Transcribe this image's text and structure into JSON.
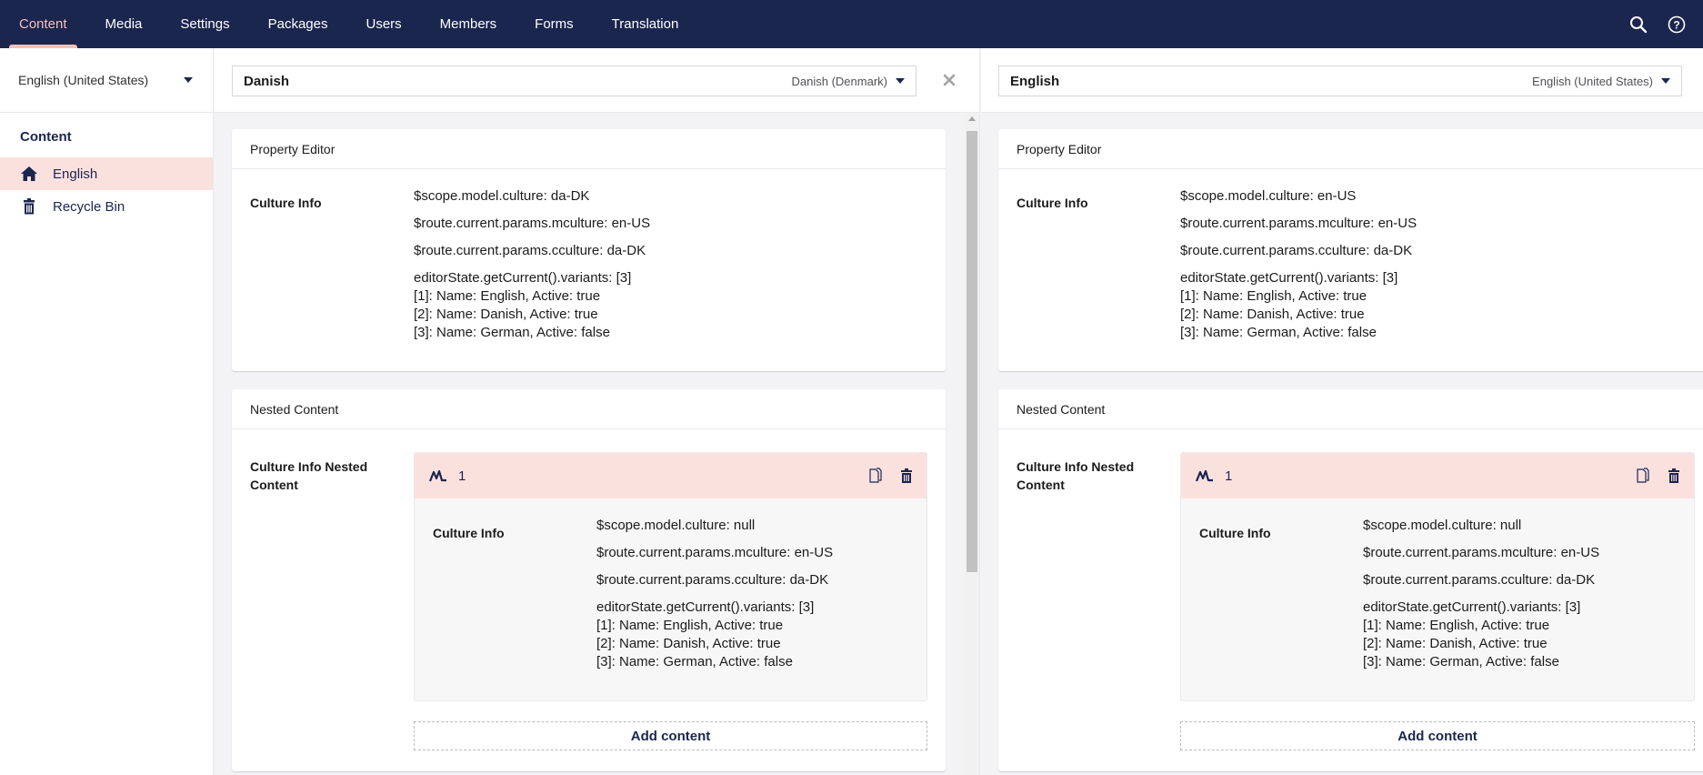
{
  "topnav": {
    "items": [
      {
        "label": "Content",
        "active": true
      },
      {
        "label": "Media"
      },
      {
        "label": "Settings"
      },
      {
        "label": "Packages"
      },
      {
        "label": "Users"
      },
      {
        "label": "Members"
      },
      {
        "label": "Forms"
      },
      {
        "label": "Translation"
      }
    ],
    "icons": [
      "search-icon",
      "help-icon"
    ]
  },
  "sidebar": {
    "culture": "English (United States)",
    "section_title": "Content",
    "items": [
      {
        "label": "English",
        "icon": "home-icon",
        "active": true
      },
      {
        "label": "Recycle Bin",
        "icon": "trash-icon"
      }
    ]
  },
  "panes": [
    {
      "variant_name": "Danish",
      "variant_culture": "Danish (Denmark)",
      "close_icon": "close-icon",
      "property_editor": {
        "header": "Property Editor",
        "label": "Culture Info",
        "lines": [
          "$scope.model.culture: da-DK",
          "$route.current.params.mculture: en-US",
          "$route.current.params.cculture: da-DK"
        ],
        "variants": [
          "editorState.getCurrent().variants: [3]",
          "[1]: Name: English, Active: true",
          "[2]: Name: Danish, Active: true",
          "[3]: Name: German, Active: false"
        ]
      },
      "nested_content": {
        "header": "Nested Content",
        "label": "Culture Info Nested Content",
        "item_title": "1",
        "item_icon": "chart-icon",
        "inner_label": "Culture Info",
        "lines": [
          "$scope.model.culture: null",
          "$route.current.params.mculture: en-US",
          "$route.current.params.cculture: da-DK"
        ],
        "variants": [
          "editorState.getCurrent().variants: [3]",
          "[1]: Name: English, Active: true",
          "[2]: Name: Danish, Active: true",
          "[3]: Name: German, Active: false"
        ],
        "add_label": "Add content"
      }
    },
    {
      "variant_name": "English",
      "variant_culture": "English (United States)",
      "property_editor": {
        "header": "Property Editor",
        "label": "Culture Info",
        "lines": [
          "$scope.model.culture: en-US",
          "$route.current.params.mculture: en-US",
          "$route.current.params.cculture: da-DK"
        ],
        "variants": [
          "editorState.getCurrent().variants: [3]",
          "[1]: Name: English, Active: true",
          "[2]: Name: Danish, Active: true",
          "[3]: Name: German, Active: false"
        ]
      },
      "nested_content": {
        "header": "Nested Content",
        "label": "Culture Info Nested Content",
        "item_title": "1",
        "item_icon": "chart-icon",
        "inner_label": "Culture Info",
        "lines": [
          "$scope.model.culture: null",
          "$route.current.params.mculture: en-US",
          "$route.current.params.cculture: da-DK"
        ],
        "variants": [
          "editorState.getCurrent().variants: [3]",
          "[1]: Name: English, Active: true",
          "[2]: Name: Danish, Active: true",
          "[3]: Name: German, Active: false"
        ],
        "add_label": "Add content"
      }
    }
  ],
  "colors": {
    "topbar": "#1b264f",
    "accent": "#f5c1bc",
    "active_bg": "#fbe1de",
    "text": "#1b264f"
  }
}
